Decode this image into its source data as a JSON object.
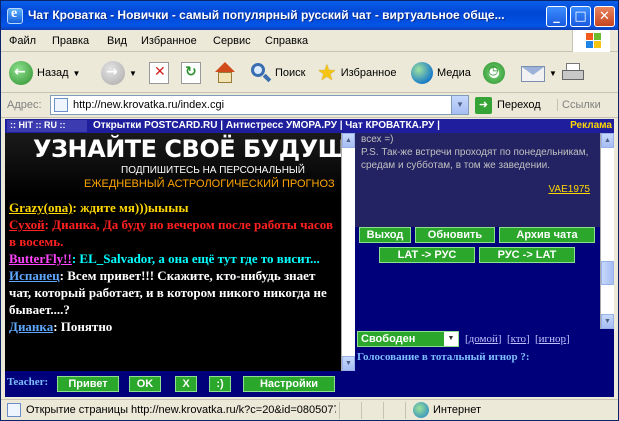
{
  "window": {
    "title": "Чат Кроватка - Новички - самый популярный русский чат - виртуальное обще...",
    "min": "_",
    "max": "□",
    "close": "✕"
  },
  "menu": [
    "Файл",
    "Правка",
    "Вид",
    "Избранное",
    "Сервис",
    "Справка"
  ],
  "toolbar": {
    "back": "Назад",
    "search": "Поиск",
    "favorites": "Избранное",
    "media": "Медиа"
  },
  "address": {
    "label": "Адрес:",
    "url": "http://new.krovatka.ru/index.cgi",
    "go": "Переход",
    "links": "Ссылки"
  },
  "topstrip": {
    "counter": ":: HIT :: RU ::",
    "links": "Открытки POSTCARD.RU | Антистресс УМОРА.РУ | Чат КРОВАТКА.РУ |",
    "reklama": "Реклама"
  },
  "banner": {
    "line1": "УЗНАЙТЕ СВОЁ БУДУЩЕЕ",
    "line2": "ПОДПИШИТЕСЬ НА ПЕРСОНАЛЬНЫЙ",
    "line3": "ЕЖЕДНЕВНЫЙ АСТРОЛОГИЧЕСКИЙ ПРОГНОЗ"
  },
  "messages": [
    {
      "nick": "Grazy(ona)",
      "text": ": ждите мя)))ыыыы",
      "color": "#FFD700",
      "nick_color": "#FFD700"
    },
    {
      "nick": "Сухой",
      "text": ": Дианка, Да буду но вечером после работы часов в восемь.",
      "color": "#FF2020",
      "nick_color": "#FF2020"
    },
    {
      "nick": "ButterFly!!",
      "text": ": EL_Salvador, а она ещё тут где то висит...",
      "color": "#00FFFF",
      "nick_color": "#FF44FF"
    },
    {
      "nick": "Испанец",
      "text": ": Всем привет!!! Скажите, кто-нибудь знает чат, который работает, и в котором никого никогда не бывает....?",
      "color": "#FFFFFF",
      "nick_color": "#5FA8FF"
    },
    {
      "nick": "Дианка",
      "text": ": Понятно",
      "color": "#FFFFFF",
      "nick_color": "#5FA8FF"
    }
  ],
  "bottombar": {
    "teacher": "Teacher:",
    "hello": "Привет",
    "ok": "OK",
    "x": "X",
    "smile": ":)",
    "settings": "Настройки"
  },
  "right_text": {
    "line1": "всех =)",
    "body": "P.S. Так-же встречи проходят по понедельникам, средам и субботам, в том же заведении.",
    "signature": "VAE1975"
  },
  "right_buttons": {
    "exit": "Выход",
    "refresh": "Обновить",
    "archive": "Архив чата",
    "lat_rus": "LAT -> РУС",
    "rus_lat": "РУС -> LAT"
  },
  "status_select": {
    "value": "Свободен"
  },
  "right_links": {
    "home": "домой",
    "who": "кто",
    "ignore": "игнор"
  },
  "vote": "Голосование в тотальный игнор ?:",
  "statusbar": {
    "text": "Открытие страницы http://new.krovatka.ru/k?c=20&id=0805077",
    "zone": "Интернет"
  }
}
